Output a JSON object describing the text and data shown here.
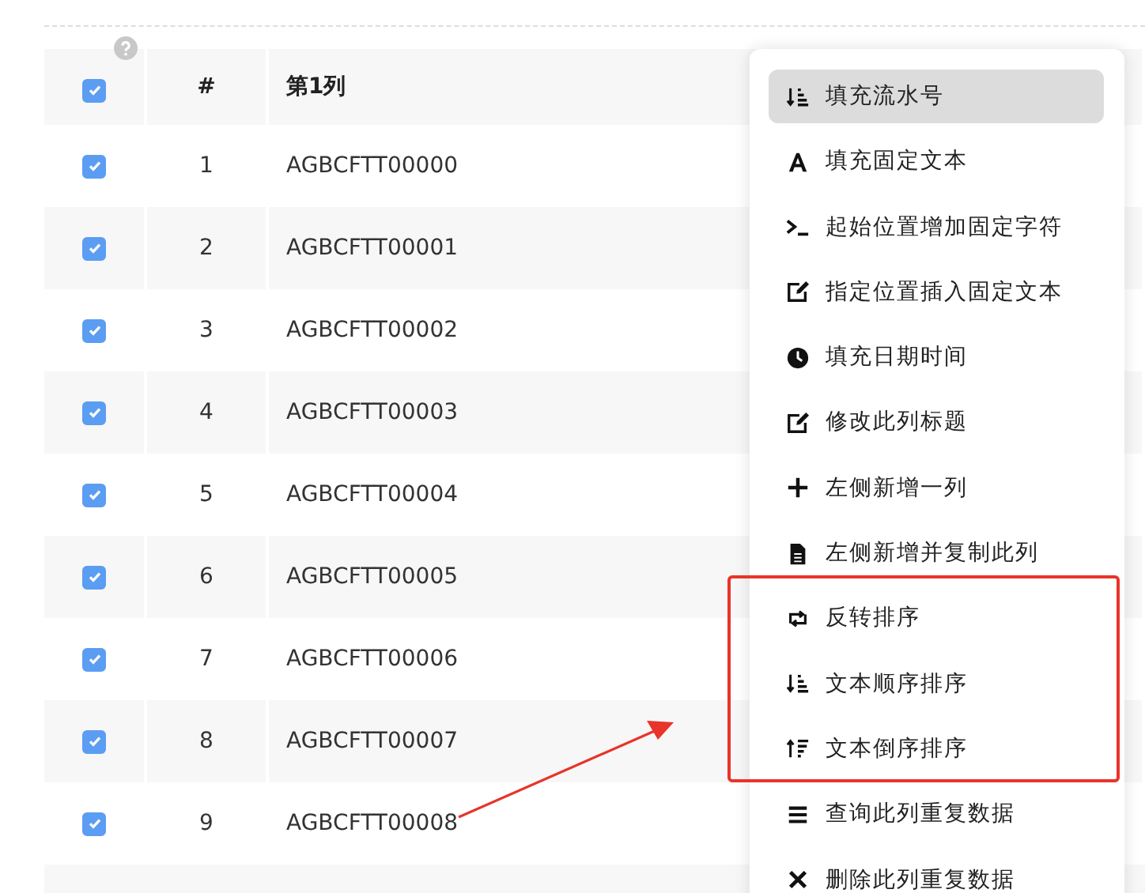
{
  "table": {
    "header": {
      "checked": true,
      "number": "#",
      "column_1": "第1列"
    },
    "rows": [
      {
        "checked": true,
        "number": "1",
        "column_1": "AGBCFTT00000"
      },
      {
        "checked": true,
        "number": "2",
        "column_1": "AGBCFTT00001"
      },
      {
        "checked": true,
        "number": "3",
        "column_1": "AGBCFTT00002"
      },
      {
        "checked": true,
        "number": "4",
        "column_1": "AGBCFTT00003"
      },
      {
        "checked": true,
        "number": "5",
        "column_1": "AGBCFTT00004"
      },
      {
        "checked": true,
        "number": "6",
        "column_1": "AGBCFTT00005"
      },
      {
        "checked": true,
        "number": "7",
        "column_1": "AGBCFTT00006"
      },
      {
        "checked": true,
        "number": "8",
        "column_1": "AGBCFTT00007"
      },
      {
        "checked": true,
        "number": "9",
        "column_1": "AGBCFTT00008"
      }
    ]
  },
  "context_menu": {
    "items": [
      {
        "label": "填充流水号",
        "selected": true
      },
      {
        "label": "填充固定文本",
        "selected": false
      },
      {
        "label": "起始位置增加固定字符",
        "selected": false
      },
      {
        "label": "指定位置插入固定文本",
        "selected": false
      },
      {
        "label": "填充日期时间",
        "selected": false
      },
      {
        "label": "修改此列标题",
        "selected": false
      },
      {
        "label": "左侧新增一列",
        "selected": false
      },
      {
        "label": "左侧新增并复制此列",
        "selected": false
      },
      {
        "label": "反转排序",
        "selected": false
      },
      {
        "label": "文本顺序排序",
        "selected": false
      },
      {
        "label": "文本倒序排序",
        "selected": false
      },
      {
        "label": "查询此列重复数据",
        "selected": false
      },
      {
        "label": "删除此列重复数据",
        "selected": false
      }
    ]
  }
}
